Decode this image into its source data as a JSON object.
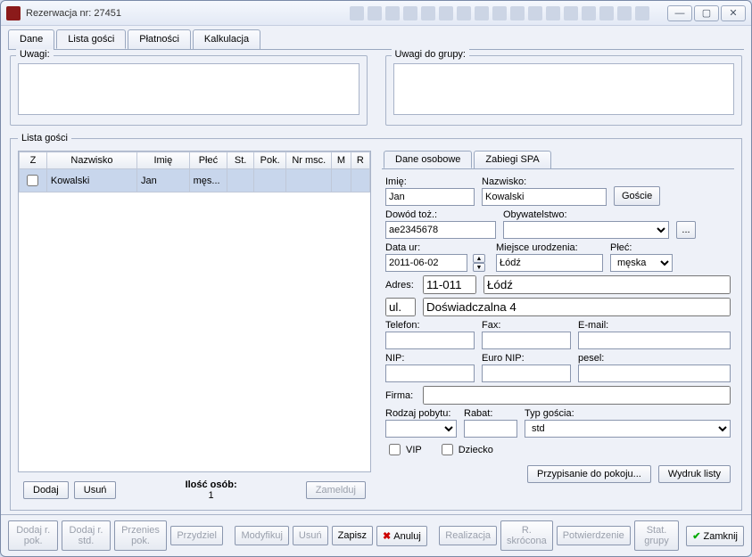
{
  "window": {
    "title": "Rezerwacja nr: 27451"
  },
  "main_tabs": [
    "Dane",
    "Lista gości",
    "Płatności",
    "Kalkulacja"
  ],
  "uwagi_label": "Uwagi:",
  "uwagi_grupy_label": "Uwagi do grupy:",
  "lista_legend": "Lista gości",
  "grid": {
    "headers": [
      "Z",
      "Nazwisko",
      "Imię",
      "Płeć",
      "St.",
      "Pok.",
      "Nr msc.",
      "M",
      "R"
    ],
    "rows": [
      {
        "z": false,
        "nazwisko": "Kowalski",
        "imie": "Jan",
        "plec": "męs...",
        "st": "",
        "pok": "",
        "nrmsc": "",
        "m": "",
        "r": ""
      }
    ]
  },
  "left_buttons": {
    "dodaj": "Dodaj",
    "usun": "Usuń",
    "zamelduj": "Zamelduj"
  },
  "count": {
    "label": "Ilość osób:",
    "value": "1"
  },
  "sub_tabs": [
    "Dane osobowe",
    "Zabiegi SPA"
  ],
  "form": {
    "imie": {
      "label": "Imię:",
      "value": "Jan"
    },
    "nazwisko": {
      "label": "Nazwisko:",
      "value": "Kowalski"
    },
    "goscie_btn": "Goście",
    "dowod": {
      "label": "Dowód toż.:",
      "value": "ae2345678"
    },
    "obyw": {
      "label": "Obywatelstwo:",
      "value": ""
    },
    "ellipsis": "...",
    "data_ur": {
      "label": "Data ur:",
      "value": "2011-06-02"
    },
    "miejsce": {
      "label": "Miejsce urodzenia:",
      "value": "Łódź"
    },
    "plec": {
      "label": "Płeć:",
      "value": "męska"
    },
    "adres_label": "Adres:",
    "adres_kod": "11-011",
    "adres_miasto": "Łódź",
    "ul_label": "ul.",
    "ul_value": "Doświadczalna 4",
    "telefon": {
      "label": "Telefon:",
      "value": ""
    },
    "fax": {
      "label": "Fax:",
      "value": ""
    },
    "email": {
      "label": "E-mail:",
      "value": ""
    },
    "nip": {
      "label": "NIP:",
      "value": ""
    },
    "euronip": {
      "label": "Euro NIP:",
      "value": ""
    },
    "pesel": {
      "label": "pesel:",
      "value": ""
    },
    "firma": {
      "label": "Firma:",
      "value": ""
    },
    "rodzaj": {
      "label": "Rodzaj pobytu:",
      "value": ""
    },
    "rabat": {
      "label": "Rabat:",
      "value": ""
    },
    "typ": {
      "label": "Typ gościa:",
      "value": "std"
    },
    "vip": "VIP",
    "dziecko": "Dziecko"
  },
  "right_buttons": {
    "przypisanie": "Przypisanie do pokoju...",
    "wydruk": "Wydruk listy"
  },
  "bottom": {
    "dodaj_pok": "Dodaj r. pok.",
    "dodaj_std": "Dodaj r. std.",
    "przenies": "Przenies pok.",
    "przydziel": "Przydziel",
    "modyfikuj": "Modyfikuj",
    "usun": "Usuń",
    "zapisz": "Zapisz",
    "anuluj": "Anuluj",
    "realizacja": "Realizacja",
    "rskrocona": "R. skrócona",
    "potwierdzenie": "Potwierdzenie",
    "statgrupy": "Stat. grupy",
    "zamknij": "Zamknij"
  }
}
